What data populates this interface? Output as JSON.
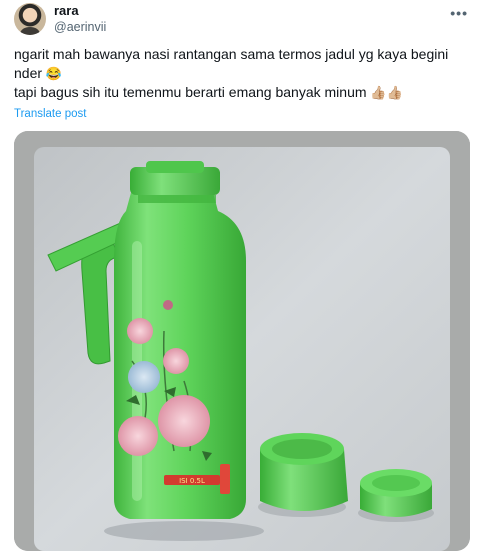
{
  "author": {
    "name": "rara",
    "handle": "@aerinvii",
    "avatar_icon": "profile-photo"
  },
  "menu_icon": "more-horizontal-icon",
  "tweet": {
    "line1": "ngarit mah bawanya nasi rantangan sama termos jadul yg kaya begini",
    "line2_text": "nder",
    "line2_emoji": "😂",
    "line3_text": "tapi bagus sih itu temenmu berarti emang banyak minum",
    "line3_emoji": "👍🏼👍🏼"
  },
  "translate_label": "Translate post",
  "media": {
    "alt_subject": "green-thermos-photo",
    "label_text": "ISI 0.5L"
  },
  "colors": {
    "link": "#1d9bf0",
    "secondary_text": "#536471",
    "thermos_green": "#5dd45a"
  }
}
